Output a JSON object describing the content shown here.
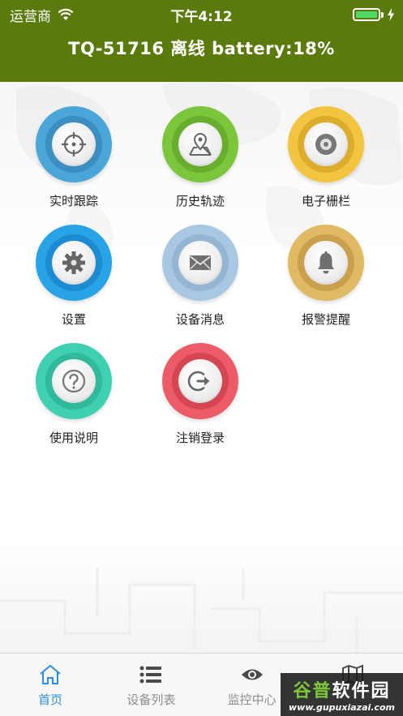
{
  "status_bar": {
    "carrier": "运营商",
    "time": "下午4:12"
  },
  "header": {
    "title": "TQ-51716 离线 battery:18%"
  },
  "menu": [
    {
      "label": "实时跟踪",
      "icon": "crosshair-icon",
      "color": "#4aa6d6"
    },
    {
      "label": "历史轨迹",
      "icon": "map-pin-icon",
      "color": "#7cc63c"
    },
    {
      "label": "电子栅栏",
      "icon": "disc-icon",
      "color": "#f2c440"
    },
    {
      "label": "设置",
      "icon": "gear-icon",
      "color": "#29a3e8"
    },
    {
      "label": "设备消息",
      "icon": "envelope-icon",
      "color": "#a9c7e2"
    },
    {
      "label": "报警提醒",
      "icon": "bell-icon",
      "color": "#e0ba62"
    },
    {
      "label": "使用说明",
      "icon": "question-icon",
      "color": "#3fd0b2"
    },
    {
      "label": "注销登录",
      "icon": "logout-icon",
      "color": "#ec5b66"
    }
  ],
  "tabs": [
    {
      "label": "首页",
      "icon": "home-icon",
      "active": true
    },
    {
      "label": "设备列表",
      "icon": "list-icon",
      "active": false
    },
    {
      "label": "监控中心",
      "icon": "eye-icon",
      "active": false
    },
    {
      "label": "",
      "icon": "map-icon",
      "active": false
    }
  ],
  "watermark": {
    "main_a": "谷普",
    "main_b": "软件园",
    "url": "www.gupuxiazai.com"
  },
  "colors": {
    "header_bg": "#5a7a0c",
    "tab_active": "#2e8de0",
    "tab_inactive": "#8e8e8e"
  }
}
